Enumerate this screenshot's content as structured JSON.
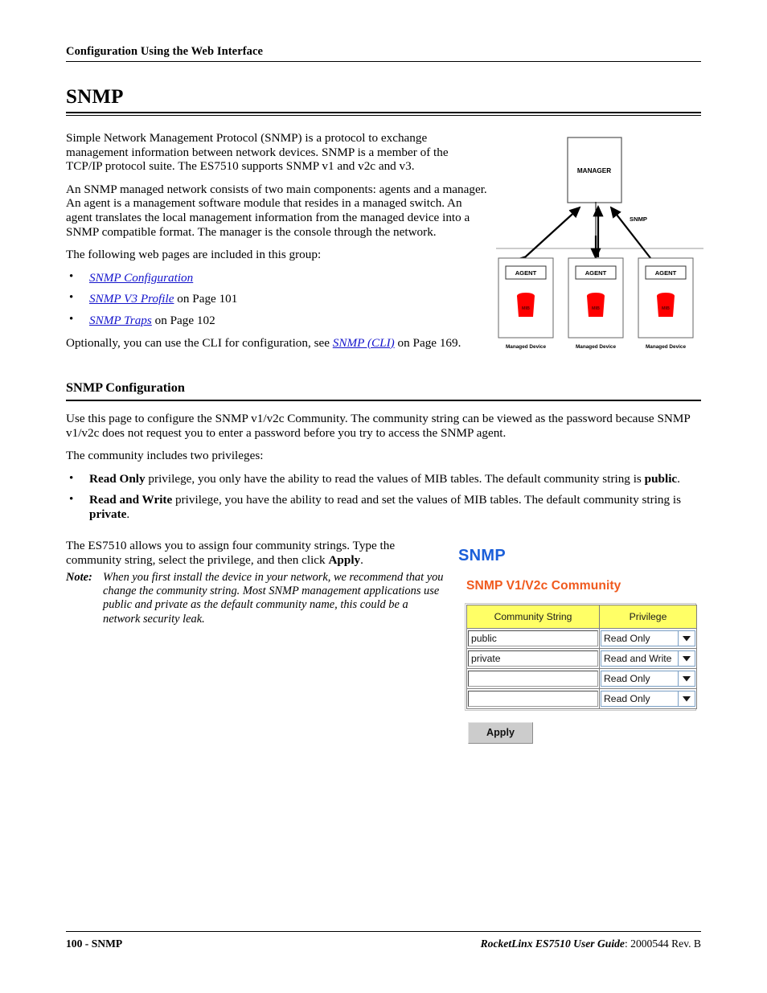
{
  "running_header": "Configuration Using the Web Interface",
  "chapter_title": "SNMP",
  "intro": {
    "para1": "Simple Network Management Protocol (SNMP) is a protocol to exchange management information between network devices. SNMP is a member of the",
    "para1b": "TCP/IP protocol suite. The ES7510 supports SNMP v1 and v2c and v3.",
    "para2": "An SNMP managed network consists of two main components: agents and a manager. An agent is a management software module that resides in a managed switch. An agent translates the local management information from the managed device into a SNMP compatible format. The manager is the console through the network.",
    "para3": "The following web pages are included in this group:",
    "links": [
      {
        "label": "SNMP Configuration",
        "suffix": ""
      },
      {
        "label": "SNMP V3 Profile",
        "suffix": " on Page 101"
      },
      {
        "label": "SNMP Traps",
        "suffix": " on Page 102"
      }
    ],
    "cli_prefix": "Optionally, you can use the CLI for configuration, see ",
    "cli_link": "SNMP (CLI)",
    "cli_suffix": " on Page 169."
  },
  "figure": {
    "manager_label": "MANAGER",
    "protocol_label": "SNMP",
    "agent_label": "AGENT",
    "mib_label": "MIB",
    "device_label": "Managed Device",
    "mib_color": "#ff0000",
    "agents": [
      {
        "agent": "AGENT",
        "mib": "MIB",
        "device": "Managed Device"
      },
      {
        "agent": "AGENT",
        "mib": "MIB",
        "device": "Managed Device"
      },
      {
        "agent": "AGENT",
        "mib": "MIB",
        "device": "Managed Device"
      }
    ]
  },
  "section": {
    "heading": "SNMP Configuration",
    "para1": "Use this page to configure the SNMP v1/v2c Community. The community string can be viewed as the password because SNMP v1/v2c does not request you to enter a password before you try to access the SNMP agent.",
    "para2": "The community includes two privileges:",
    "privileges": [
      {
        "name": "Read Only",
        "text_mid": " privilege, you only have the ability to read the values of MIB tables. The default community string is ",
        "default": "public",
        "text_end": "."
      },
      {
        "name": "Read and Write",
        "text_mid": " privilege, you have the ability to read and set the values of MIB tables. The default community string is ",
        "default": "private",
        "text_end": "."
      }
    ],
    "para3_a": "The ES7510 allows you to assign four community strings. Type the community string, select the privilege, and then click ",
    "para3_bold": "Apply",
    "para3_b": ".",
    "note_label": "Note:",
    "note_body": "When you first install the device in your network, we recommend that you change the community string. Most SNMP management applications use public and private as the default community name, this could be a network security leak."
  },
  "ui": {
    "title": "SNMP",
    "title_color": "#1b5fd9",
    "subtitle": "SNMP V1/V2c Community",
    "subtitle_color": "#f05a1e",
    "header_bg": "#ffff66",
    "columns": [
      "Community String",
      "Privilege"
    ],
    "rows": [
      {
        "community": "public",
        "privilege": "Read Only"
      },
      {
        "community": "private",
        "privilege": "Read and Write"
      },
      {
        "community": "",
        "privilege": "Read Only"
      },
      {
        "community": "",
        "privilege": "Read Only"
      }
    ],
    "privilege_options": [
      "Read Only",
      "Read and Write"
    ],
    "apply_label": "Apply"
  },
  "footer": {
    "left_page": "100 - ",
    "left_section": "SNMP",
    "right_book": "RocketLinx ES7510  User Guide",
    "right_rest": ": 2000544 Rev. B"
  }
}
